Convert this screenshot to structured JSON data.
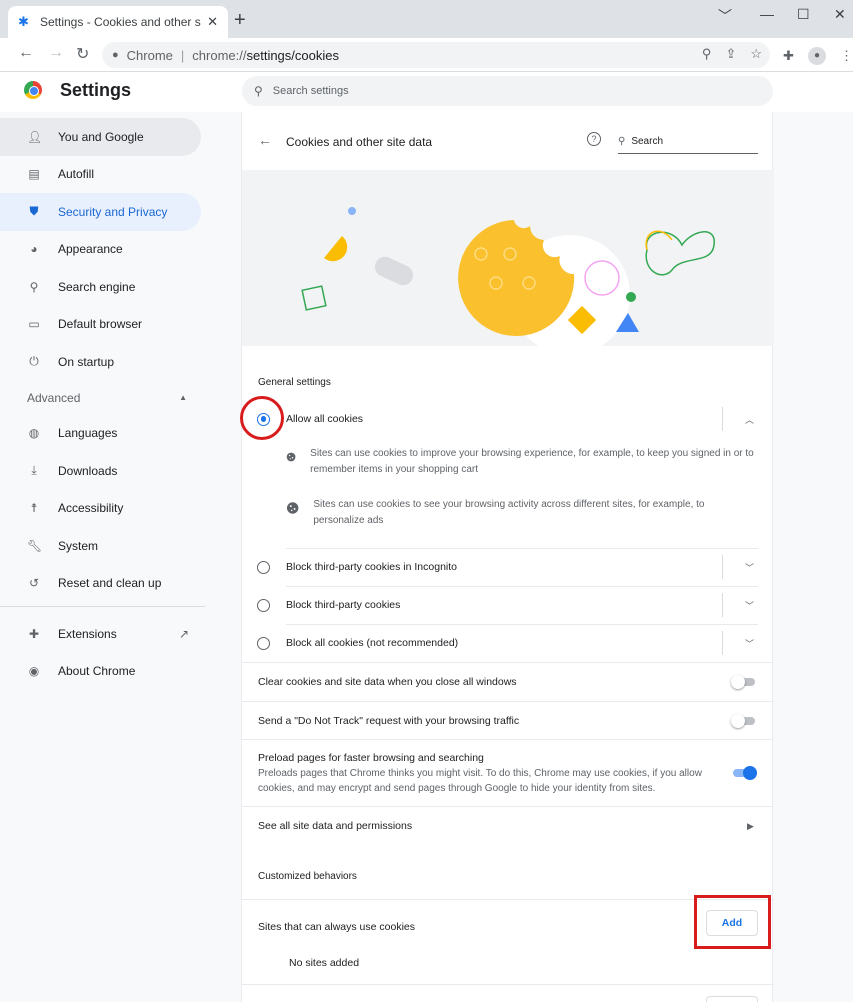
{
  "browser": {
    "tab_title": "Settings - Cookies and other site",
    "tab_close": "✕",
    "new_tab": "+",
    "window_controls": [
      "﹀",
      "—",
      "☐",
      "✕"
    ],
    "omnibox": {
      "site_label": "Chrome",
      "separator": "|",
      "scheme": "chrome://",
      "path": "settings/cookies"
    }
  },
  "header": {
    "title": "Settings",
    "search_placeholder": "Search settings"
  },
  "sidebar": {
    "items": [
      {
        "label": "You and Google",
        "icon": "person-icon"
      },
      {
        "label": "Autofill",
        "icon": "clipboard-icon"
      },
      {
        "label": "Security and Privacy",
        "icon": "shield-icon"
      },
      {
        "label": "Appearance",
        "icon": "palette-icon"
      },
      {
        "label": "Search engine",
        "icon": "search-icon"
      },
      {
        "label": "Default browser",
        "icon": "browser-icon"
      },
      {
        "label": "On startup",
        "icon": "power-icon"
      }
    ],
    "advanced_label": "Advanced",
    "advanced_items": [
      {
        "label": "Languages",
        "icon": "globe-icon"
      },
      {
        "label": "Downloads",
        "icon": "download-icon"
      },
      {
        "label": "Accessibility",
        "icon": "accessibility-icon"
      },
      {
        "label": "System",
        "icon": "wrench-icon"
      },
      {
        "label": "Reset and clean up",
        "icon": "restore-icon"
      }
    ],
    "extensions_label": "Extensions",
    "about_label": "About Chrome"
  },
  "page": {
    "title": "Cookies and other site data",
    "search_placeholder": "Search",
    "general_settings_label": "General settings",
    "options": [
      {
        "label": "Allow all cookies",
        "checked": true,
        "expanded": true
      },
      {
        "label": "Block third-party cookies in Incognito",
        "checked": false
      },
      {
        "label": "Block third-party cookies",
        "checked": false
      },
      {
        "label": "Block all cookies (not recommended)",
        "checked": false
      }
    ],
    "allow_all_descriptions": [
      "Sites can use cookies to improve your browsing experience, for example, to keep you signed in or to remember items in your shopping cart",
      "Sites can use cookies to see your browsing activity across different sites, for example, to personalize ads"
    ],
    "toggles": [
      {
        "label": "Clear cookies and site data when you close all windows",
        "on": false
      },
      {
        "label": "Send a \"Do Not Track\" request with your browsing traffic",
        "on": false
      },
      {
        "label": "Preload pages for faster browsing and searching",
        "sub": "Preloads pages that Chrome thinks you might visit. To do this, Chrome may use cookies, if you allow cookies, and may encrypt and send pages through Google to hide your identity from sites.",
        "on": true
      }
    ],
    "see_all_label": "See all site data and permissions",
    "customized_label": "Customized behaviors",
    "always_use_label": "Sites that can always use cookies",
    "add_label": "Add",
    "no_sites_label": "No sites added"
  },
  "colors": {
    "accent": "#1a73e8",
    "highlight_red": "#d81b1b",
    "selected_nav_bg": "#e8f0fe"
  }
}
